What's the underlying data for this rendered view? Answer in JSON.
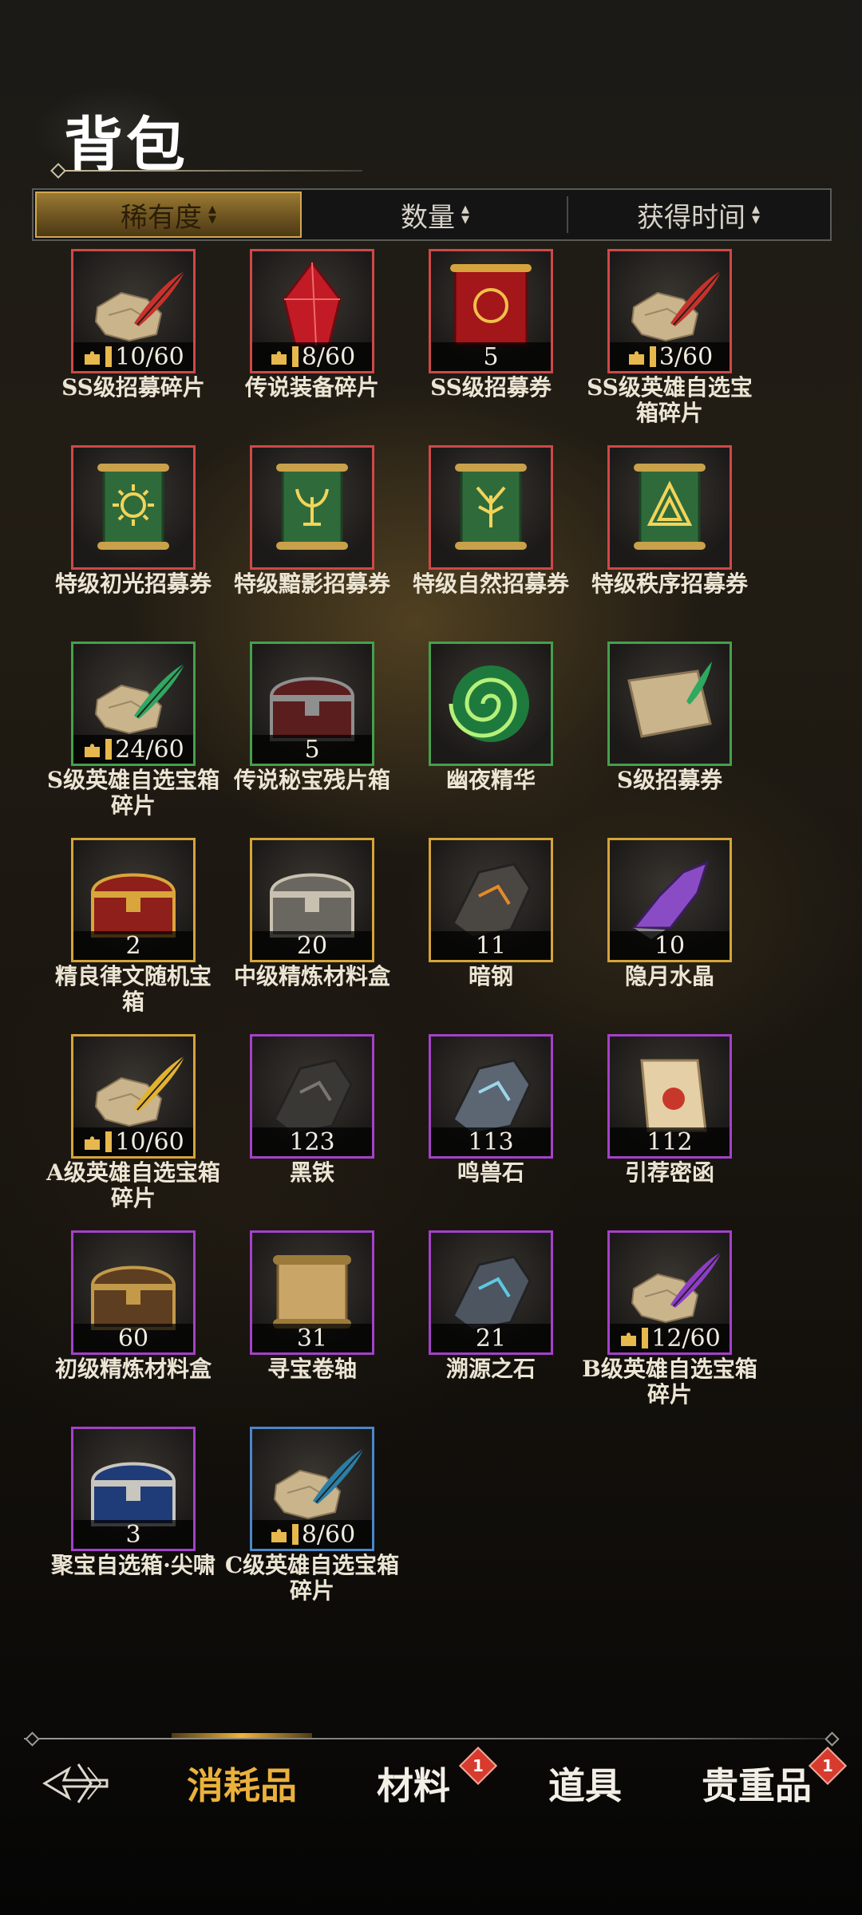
{
  "page": {
    "title": "背包"
  },
  "sort": {
    "tabs": [
      {
        "label": "稀有度",
        "active": true
      },
      {
        "label": "数量",
        "active": false
      },
      {
        "label": "获得时间",
        "active": false
      }
    ],
    "arrow_glyph": "◆"
  },
  "items": [
    {
      "name": "SS级招募碎片",
      "count": "10/60",
      "fragment": true,
      "rarity": "red",
      "icon": "scroll-fragment-red-quill"
    },
    {
      "name": "传说装备碎片",
      "count": "8/60",
      "fragment": true,
      "rarity": "red",
      "icon": "red-crystal"
    },
    {
      "name": "SS级招募券",
      "count": "5",
      "fragment": false,
      "rarity": "red",
      "icon": "red-scroll"
    },
    {
      "name": "SS级英雄自选宝箱碎片",
      "count": "3/60",
      "fragment": true,
      "rarity": "red",
      "icon": "scroll-fragment-red-quill"
    },
    {
      "name": "特级初光招募券",
      "count": "",
      "fragment": false,
      "rarity": "red",
      "icon": "green-scroll-sun"
    },
    {
      "name": "特级黯影招募券",
      "count": "",
      "fragment": false,
      "rarity": "red",
      "icon": "green-scroll-shadow"
    },
    {
      "name": "特级自然招募券",
      "count": "",
      "fragment": false,
      "rarity": "red",
      "icon": "green-scroll-tree"
    },
    {
      "name": "特级秩序招募券",
      "count": "",
      "fragment": false,
      "rarity": "red",
      "icon": "green-scroll-triangle"
    },
    {
      "name": "S级英雄自选宝箱碎片",
      "count": "24/60",
      "fragment": true,
      "rarity": "green",
      "icon": "scroll-fragment-green-quill"
    },
    {
      "name": "传说秘宝残片箱",
      "count": "5",
      "fragment": false,
      "rarity": "green",
      "icon": "dark-chest"
    },
    {
      "name": "幽夜精华",
      "count": "",
      "fragment": false,
      "rarity": "green",
      "icon": "green-vortex"
    },
    {
      "name": "S级招募券",
      "count": "",
      "fragment": false,
      "rarity": "green",
      "icon": "parchment-green-quill"
    },
    {
      "name": "精良律文随机宝箱",
      "count": "2",
      "fragment": false,
      "rarity": "gold",
      "icon": "red-gold-chest"
    },
    {
      "name": "中级精炼材料盒",
      "count": "20",
      "fragment": false,
      "rarity": "gold",
      "icon": "silver-chest"
    },
    {
      "name": "暗钢",
      "count": "11",
      "fragment": false,
      "rarity": "gold",
      "icon": "dark-steel"
    },
    {
      "name": "隐月水晶",
      "count": "10",
      "fragment": false,
      "rarity": "gold",
      "icon": "purple-crystal"
    },
    {
      "name": "A级英雄自选宝箱碎片",
      "count": "10/60",
      "fragment": true,
      "rarity": "gold",
      "icon": "scroll-fragment-gold-quill"
    },
    {
      "name": "黑铁",
      "count": "123",
      "fragment": false,
      "rarity": "purple",
      "icon": "black-iron"
    },
    {
      "name": "鸣兽石",
      "count": "113",
      "fragment": false,
      "rarity": "purple",
      "icon": "beast-stone"
    },
    {
      "name": "引荐密函",
      "count": "112",
      "fragment": false,
      "rarity": "purple",
      "icon": "sealed-letter"
    },
    {
      "name": "初级精炼材料盒",
      "count": "60",
      "fragment": false,
      "rarity": "purple",
      "icon": "wooden-chest"
    },
    {
      "name": "寻宝卷轴",
      "count": "31",
      "fragment": false,
      "rarity": "purple",
      "icon": "treasure-scroll"
    },
    {
      "name": "溯源之石",
      "count": "21",
      "fragment": false,
      "rarity": "purple",
      "icon": "origin-stone"
    },
    {
      "name": "B级英雄自选宝箱碎片",
      "count": "12/60",
      "fragment": true,
      "rarity": "purple",
      "icon": "scroll-fragment-purple-quill"
    },
    {
      "name": "聚宝自选箱·尖啸",
      "count": "3",
      "fragment": false,
      "rarity": "purple",
      "icon": "blue-chest"
    },
    {
      "name": "C级英雄自选宝箱碎片",
      "count": "8/60",
      "fragment": true,
      "rarity": "blue",
      "icon": "scroll-fragment-blue-quill"
    }
  ],
  "nav": {
    "back_icon": "back-arrow-icon",
    "tabs": [
      {
        "label": "消耗品",
        "active": true,
        "badge": ""
      },
      {
        "label": "材料",
        "active": false,
        "badge": "1"
      },
      {
        "label": "道具",
        "active": false,
        "badge": ""
      },
      {
        "label": "贵重品",
        "active": false,
        "badge": "1"
      }
    ]
  },
  "colors": {
    "red": "#cf4848",
    "green": "#45a04d",
    "gold": "#d5a43a",
    "purple": "#a441c9",
    "blue": "#4b86c9",
    "accent": "#eab13c",
    "badge": "#d63b2e"
  }
}
